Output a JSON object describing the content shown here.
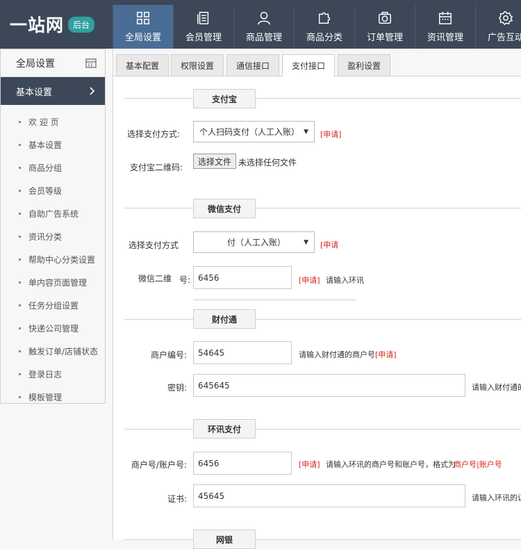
{
  "logo": {
    "name": "一站网",
    "badge": "后台"
  },
  "nav": [
    {
      "label": "全局设置",
      "icon": "grid-icon"
    },
    {
      "label": "会员管理",
      "icon": "document-icon"
    },
    {
      "label": "商品管理",
      "icon": "user-icon"
    },
    {
      "label": "商品分类",
      "icon": "puzzle-icon"
    },
    {
      "label": "订单管理",
      "icon": "camera-icon"
    },
    {
      "label": "资讯管理",
      "icon": "calendar-icon"
    },
    {
      "label": "广告互动",
      "icon": "gear-icon"
    }
  ],
  "sidebar": {
    "title": "全局设置",
    "section": "基本设置",
    "items": [
      "欢 迎 页",
      "基本设置",
      "商品分组",
      "会员等级",
      "自助广告系统",
      "资讯分类",
      "帮助中心分类设置",
      "单内容页面管理",
      "任务分组设置",
      "快递公司管理",
      "触发订单/店铺状态",
      "登录日志",
      "模板管理"
    ]
  },
  "tabs": [
    "基本配置",
    "权限设置",
    "通信接口",
    "支付接口",
    "盈利设置"
  ],
  "alipay": {
    "title": "支付宝",
    "method_label": "选择支付方式:",
    "method_value": "个人扫码支付（人工入账）",
    "apply": "[申请]",
    "qr_label": "支付宝二维码:",
    "file_button": "选择文件",
    "file_status": "未选择任何文件"
  },
  "wechat": {
    "title": "微信支付",
    "method_label": "选择支付方式",
    "method_value": "付（人工入账）",
    "apply": "[申请",
    "qr_label": "微信二维",
    "qr_label_tail": "号:",
    "qr_value": "6456",
    "apply2": "[申请]",
    "hint": "请输入环讯"
  },
  "tenpay": {
    "title": "财付通",
    "merchant_label": "商户编号:",
    "merchant_value": "54645",
    "merchant_hint": "请输入财付通的商户号",
    "apply": "[申请]",
    "key_label": "密钥:",
    "key_value": "645645",
    "key_hint": "请输入财付通的"
  },
  "ips": {
    "title": "环讯支付",
    "merchant_label": "商户号/账户号:",
    "merchant_value": "6456",
    "apply": "[申请]",
    "merchant_hint": "请输入环讯的商户号和账户号，格式为",
    "merchant_format": "商户号|账户号",
    "cert_label": "证书:",
    "cert_value": "45645",
    "cert_hint": "请输入环讯的证"
  },
  "next_section": {
    "title": "网银"
  }
}
